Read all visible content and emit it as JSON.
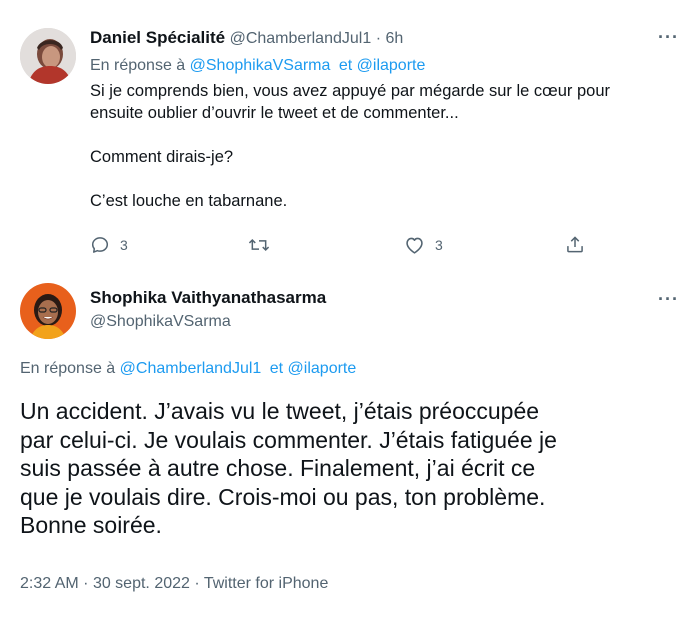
{
  "tweet1": {
    "display_name": "Daniel Spécialité",
    "handle": "@ChamberlandJul1",
    "separator": "·",
    "time": "6h",
    "reply_prefix": "En réponse à",
    "reply_to_1": "@ShophikaVSarma",
    "reply_and": "et",
    "reply_to_2": "@ilaporte",
    "text_line1": "Si je comprends bien, vous avez appuyé par mégarde sur le cœur pour",
    "text_line2": "ensuite oublier d’ouvrir le tweet et de commenter...",
    "text_line3": "Comment dirais-je?",
    "text_line4": "C’est louche en tabarnane.",
    "reply_count": "3",
    "like_count": "3",
    "more_icon": "more-dots-icon"
  },
  "tweet2": {
    "display_name": "Shophika Vaithyanathasarma",
    "handle": "@ShophikaVSarma",
    "reply_prefix": "En réponse à",
    "reply_to_1": "@ChamberlandJul1",
    "reply_and": "et",
    "reply_to_2": "@ilaporte",
    "text_line1": "Un accident. J’avais vu le tweet, j’étais préoccupée",
    "text_line2": "par celui-ci. Je voulais commenter. J’étais fatiguée je",
    "text_line3": "suis passée à autre chose. Finalement, j’ai écrit ce",
    "text_line4": "que je voulais dire. Crois-moi ou pas, ton problème.",
    "text_line5": "Bonne soirée.",
    "time": "2:32 AM",
    "separator": "·",
    "date": "30 sept. 2022",
    "source": "Twitter for iPhone"
  },
  "colors": {
    "link": "#1d9bf0",
    "muted": "#536471",
    "text": "#0f1419",
    "thread_line": "#cfd9de"
  }
}
